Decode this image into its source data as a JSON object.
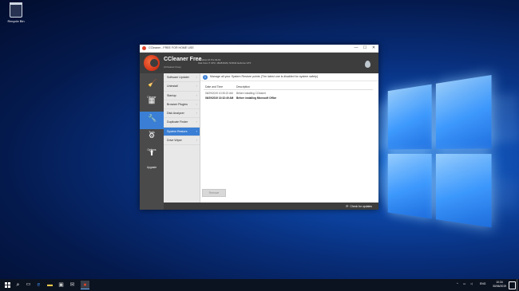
{
  "desktop": {
    "recycle_bin_label": "Recycle Bin"
  },
  "window": {
    "title": "CCleaner - FREE FOR HOME USE",
    "controls": {
      "minimize": "—",
      "maximize": "☐",
      "close": "✕"
    }
  },
  "header": {
    "app_name": "CCleaner Free",
    "edition": "(CCleaner Free)",
    "sysinfo_line1": "Windows 10 Pro 64-bit",
    "sysinfo_line2": "Intel Core i7 CPU, 16GB RAM, NVIDIA GeForce GTX"
  },
  "sidebar": {
    "items": [
      {
        "label": "Cleaner",
        "icon": "broom-icon"
      },
      {
        "label": "Registry",
        "icon": "registry-grid-icon"
      },
      {
        "label": "Tools",
        "icon": "wrench-icon",
        "active": true
      },
      {
        "label": "Options",
        "icon": "gear-icon"
      },
      {
        "label": "Upgrade",
        "icon": "upgrade-arrow-icon"
      }
    ]
  },
  "submenu": {
    "items": [
      {
        "label": "Software Updater"
      },
      {
        "label": "Uninstall"
      },
      {
        "label": "Startup"
      },
      {
        "label": "Browser Plugins"
      },
      {
        "label": "Disk Analyzer"
      },
      {
        "label": "Duplicate Finder"
      },
      {
        "label": "System Restore",
        "active": true
      },
      {
        "label": "Drive Wiper"
      }
    ]
  },
  "content": {
    "info_text": "Manage all your System Restore points (The latest one is disabled for system safety)",
    "table": {
      "headers": [
        "Date and Time",
        "Description"
      ],
      "rows": [
        {
          "date": "06/29/2019 10:35:22 AM",
          "description": "Before installing CCleaner"
        },
        {
          "date": "06/29/2019 10:32:49 AM",
          "description": "Before installing Microsoft Office"
        }
      ]
    },
    "remove_button": "Remove"
  },
  "footer": {
    "check_updates": "Check for updates"
  },
  "taskbar": {
    "tray_lang": "ENG",
    "time": "10:34",
    "date": "30/06/2019"
  },
  "colors": {
    "accent": "#3a7fd5",
    "header_bg": "#3d3d3d",
    "sidebar_bg": "#4a4a4a"
  }
}
